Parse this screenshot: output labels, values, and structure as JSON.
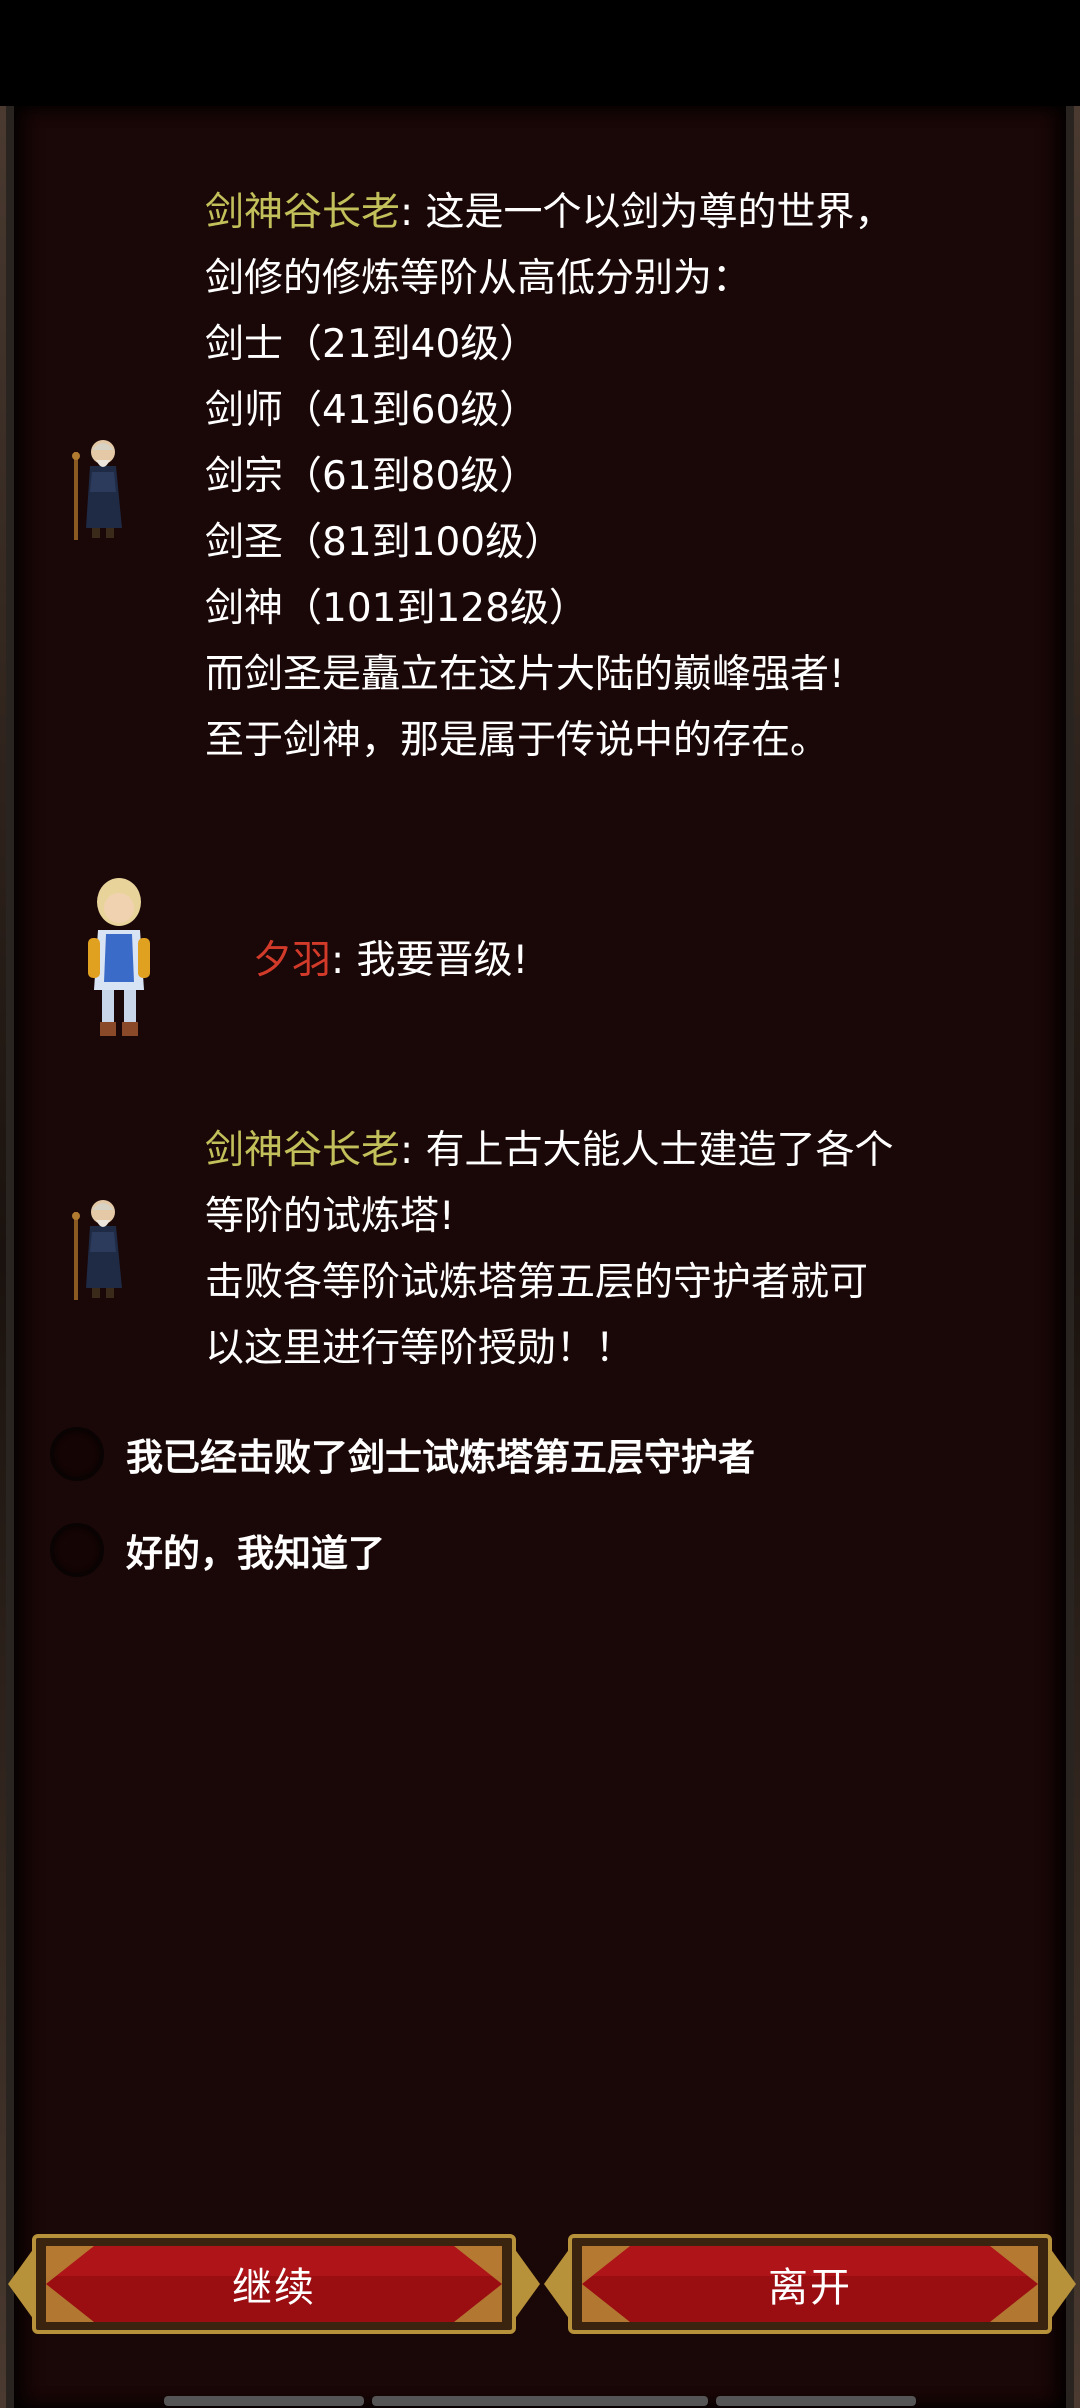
{
  "dialog": [
    {
      "speaker": "剑神谷长老",
      "lines": [
        ": 这是一个以剑为尊的世界，",
        "剑修的修炼等阶从高低分别为：",
        "剑士（21到40级）",
        "剑师（41到60级）",
        "剑宗（61到80级）",
        "剑圣（81到100级）",
        "剑神（101到128级）",
        "而剑圣是矗立在这片大陆的巅峰强者!",
        "至于剑神，那是属于传说中的存在。"
      ]
    },
    {
      "speaker": "夕羽",
      "lines": [
        ": 我要晋级!"
      ]
    },
    {
      "speaker": "剑神谷长老",
      "lines": [
        ": 有上古大能人士建造了各个",
        "等阶的试炼塔!",
        "击败各等阶试炼塔第五层的守护者就可",
        "以这里进行等阶授勋！！"
      ]
    }
  ],
  "options": [
    "我已经击败了剑士试炼塔第五层守护者",
    "好的，我知道了"
  ],
  "buttons": {
    "continue": "继续",
    "leave": "离开"
  },
  "colors": {
    "panel_bg": "#1a0707",
    "npc_name": "#c2c05a",
    "player_name": "#d23a2a",
    "button_red": "#9a0e12",
    "button_gold": "#b8923a"
  },
  "icons": {
    "npc": "elder-npc-sprite",
    "player": "player-character-sprite"
  }
}
